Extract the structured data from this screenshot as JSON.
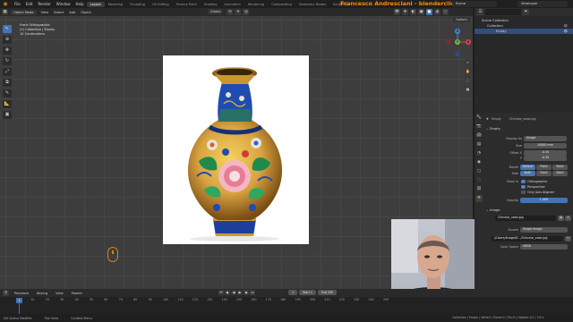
{
  "topbar": {
    "menus": [
      "File",
      "Edit",
      "Render",
      "Window",
      "Help"
    ],
    "workspaces": [
      "Layout",
      "Modeling",
      "Sculpting",
      "UV Editing",
      "Texture Paint",
      "Shading",
      "Animation",
      "Rendering",
      "Compositing",
      "Geometry Nodes",
      "Scripting"
    ],
    "active_workspace": "Layout",
    "brand": "Francesco Andresciani - blenderclick.it",
    "scene": "Scene",
    "view_layer": "ViewLayer"
  },
  "viewport_header": {
    "mode": "Object Mode",
    "menus": [
      "View",
      "Select",
      "Add",
      "Object"
    ],
    "orientation": "Global",
    "options": "Options"
  },
  "viewport": {
    "info_line1": "Front Orthographic",
    "info_line2": "(1) Collection | Empty",
    "info_line3": "10 Centimeters"
  },
  "gizmo": {
    "x": "X",
    "y": "Y",
    "z": "Z"
  },
  "outliner": {
    "root": "Scene Collection",
    "collection": "Collection",
    "selected_item": "Empty"
  },
  "properties": {
    "object_name": "Empty",
    "image_name": "Chinese_vase.jpg",
    "section_empty": "Empty",
    "display_as_label": "Display As",
    "display_as_value": "Image",
    "size_label": "Size",
    "size_value": "10000 mm",
    "offset_x_label": "Offset X",
    "offset_x_value": "-0.50",
    "offset_y_label": "Y",
    "offset_y_value": "-0.50",
    "depth_label": "Depth",
    "depth_options": [
      "Default",
      "Front",
      "Back"
    ],
    "side_label": "Side",
    "side_options": [
      "Both",
      "Front",
      "Back"
    ],
    "show_in_label": "Show In",
    "show_orthographic": "Orthographic",
    "show_perspective": "Perspective",
    "show_axis_aligned": "Only Axis Aligned",
    "opacity_label": "Opacity",
    "opacity_value": "1.000",
    "section_image": "Image",
    "image_field": "Chinese_vase.jpg",
    "source_label": "Source",
    "source_value": "Single Image",
    "path_value": "//Users/Image/D.../Chinese_vase.jpg",
    "color_space_label": "Color Space",
    "color_space_value": "sRGB"
  },
  "timeline": {
    "menus": [
      "Playback",
      "Keying",
      "View",
      "Marker"
    ],
    "current_frame": "1",
    "ticks": [
      "0",
      "10",
      "20",
      "30",
      "40",
      "50",
      "60",
      "70",
      "80",
      "90",
      "100",
      "110",
      "120",
      "130",
      "140",
      "150",
      "160",
      "170",
      "180",
      "190",
      "200",
      "210",
      "220",
      "230",
      "240",
      "250"
    ],
    "frame_current_field": "1",
    "start_label": "Start",
    "start_value": "1",
    "end_label": "End",
    "end_value": "250"
  },
  "statusbar": {
    "item1": "Set Active Modifier",
    "item2": "Pan View",
    "item3": "Context Menu",
    "right": "Collection | Empty | Verts:0 | Faces:0 | Tris:0 | Objects:1/1 | 3.6.1"
  },
  "colors": {
    "accent_blue": "#4772b3",
    "brand_orange": "#ff8c00",
    "viewport_bg": "#3d3d3d"
  }
}
